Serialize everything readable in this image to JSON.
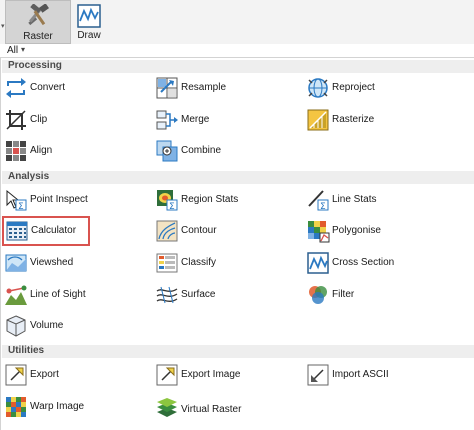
{
  "ribbon": {
    "buttons": [
      {
        "label": "Raster",
        "icon": "raster-tools-icon",
        "active": true
      },
      {
        "label": "Draw",
        "icon": "draw-icon",
        "active": false
      }
    ]
  },
  "filter": {
    "label": "All",
    "arrow": "▾"
  },
  "sections": [
    {
      "title": "Processing",
      "items": [
        "Convert",
        "Resample",
        "Reproject",
        "Clip",
        "Merge",
        "Rasterize",
        "Align",
        "Combine"
      ]
    },
    {
      "title": "Analysis",
      "items": [
        "Point Inspect",
        "Region Stats",
        "Line Stats",
        "Calculator",
        "Contour",
        "Polygonise",
        "Viewshed",
        "Classify",
        "Cross Section",
        "Line of Sight",
        "Surface",
        "Filter",
        "Volume"
      ]
    },
    {
      "title": "Utilities",
      "items": [
        "Export",
        "Export Image",
        "Import ASCII",
        "Warp Image",
        "Virtual Raster"
      ]
    }
  ],
  "selected_item": "Calculator",
  "colors": {
    "selection_border": "#d9534f",
    "section_bg": "#eeeeee",
    "accent_blue": "#2b79c2"
  }
}
